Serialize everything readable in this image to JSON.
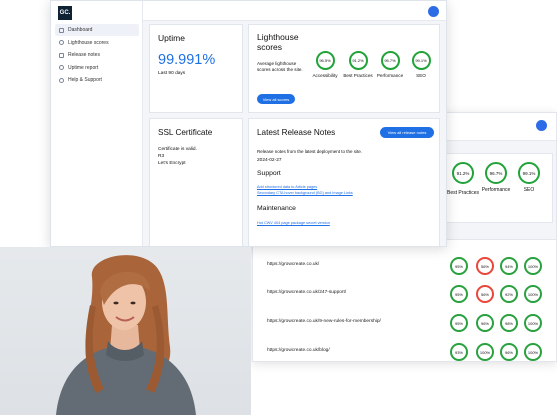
{
  "brand": {
    "logo": "GC."
  },
  "sidebar": {
    "items": [
      {
        "label": "Dashboard"
      },
      {
        "label": "Lighthouse scores"
      },
      {
        "label": "Release notes"
      },
      {
        "label": "Uptime report"
      },
      {
        "label": "Help & Support"
      }
    ]
  },
  "uptime": {
    "title": "Uptime",
    "value": "99.991%",
    "period": "Last 90 days"
  },
  "lighthouse": {
    "title": "Lighthouse scores",
    "description": "Average lighthouse scores across the site.",
    "button": "View all scores",
    "scores": [
      {
        "label": "Accessibility",
        "value": "96.5%"
      },
      {
        "label": "Best Practices",
        "value": "91.2%"
      },
      {
        "label": "Performance",
        "value": "95.7%"
      },
      {
        "label": "SEO",
        "value": "99.1%"
      }
    ]
  },
  "ssl": {
    "title": "SSL Certificate",
    "line1": "Certificate is valid.",
    "line2": "R3",
    "line3": "Let's Encrypt"
  },
  "release": {
    "title": "Latest Release Notes",
    "button": "View all release notes",
    "intro": "Release notes from the latest deployment to the site.",
    "date": "2024-02-27",
    "support_heading": "Support",
    "support_links": [
      "Add structured data to Article pages",
      "Secondary CTA hover background (BG) and Image Links"
    ],
    "maintenance_heading": "Maintenance",
    "maintenance_links": [
      "Hot CWV 404 page package secret version"
    ]
  },
  "back_window": {
    "scores": [
      {
        "label": "",
        "value": "91.2%"
      },
      {
        "label": "Best Practices",
        "value": "91.2%"
      },
      {
        "label": "Performance",
        "value": "96.7%"
      },
      {
        "label": "SEO",
        "value": "99.1%"
      }
    ],
    "rows": [
      {
        "url": "https://growcreate.co.uk/",
        "scores": [
          "95%",
          "56%",
          "94%",
          "100%"
        ]
      },
      {
        "url": "https://growcreate.co.uk/247-support/",
        "scores": [
          "95%",
          "56%",
          "92%",
          "100%"
        ]
      },
      {
        "url": "https://growcreate.co.uk/9-new-rules-for-membership/",
        "scores": [
          "95%",
          "96%",
          "98%",
          "100%"
        ]
      },
      {
        "url": "https://growcreate.co.uk/blog/",
        "scores": [
          "93%",
          "100%",
          "96%",
          "100%"
        ]
      }
    ]
  }
}
